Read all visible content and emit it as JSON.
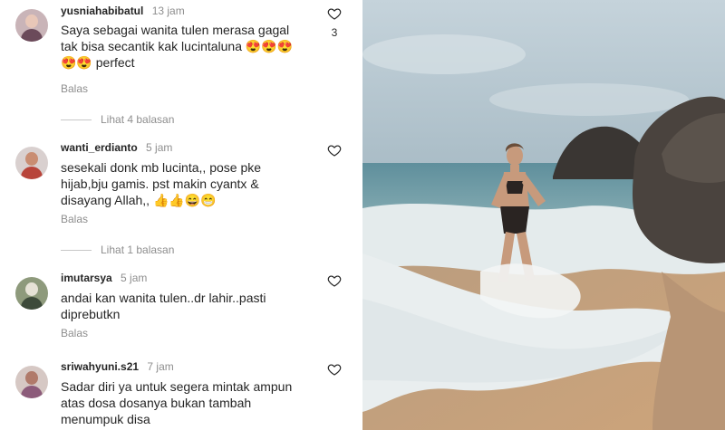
{
  "comments": [
    {
      "username": "yusniahabibatul",
      "time": "13 jam",
      "text_line1": "Saya sebagai wanita tulen merasa gagal",
      "text_line2": "tak bisa secantik kak lucintaluna 😍😍😍",
      "text_line3": "😍😍 perfect",
      "reply_label": "Balas",
      "like_count": "3",
      "view_replies": "Lihat 4 balasan"
    },
    {
      "username": "wanti_erdianto",
      "time": "5 jam",
      "text_line1": "sesekali donk mb lucinta,, pose pke",
      "text_line2": "hijab,bju gamis. pst makin cyantx &",
      "text_line3": "disayang Allah,, 👍👍😄😁",
      "reply_label": "Balas",
      "view_replies": "Lihat 1 balasan"
    },
    {
      "username": "imutarsya",
      "time": "5 jam",
      "text_line1": "andai kan wanita tulen..dr lahir..pasti",
      "text_line2": "diprebutkn",
      "reply_label": "Balas"
    },
    {
      "username": "sriwahyuni.s21",
      "time": "7 jam",
      "text_line1": "Sadar diri ya untuk segera mintak ampun",
      "text_line2": "atas dosa dosanya bukan tambah",
      "text_line3": "menumpuk disa"
    }
  ],
  "colors": {
    "text": "#262626",
    "muted": "#8e8e8e",
    "sky": "#aebfc9",
    "sea": "#6f9ba6",
    "sand": "#c8a27e"
  },
  "icons": {
    "like": "heart-outline-icon"
  }
}
